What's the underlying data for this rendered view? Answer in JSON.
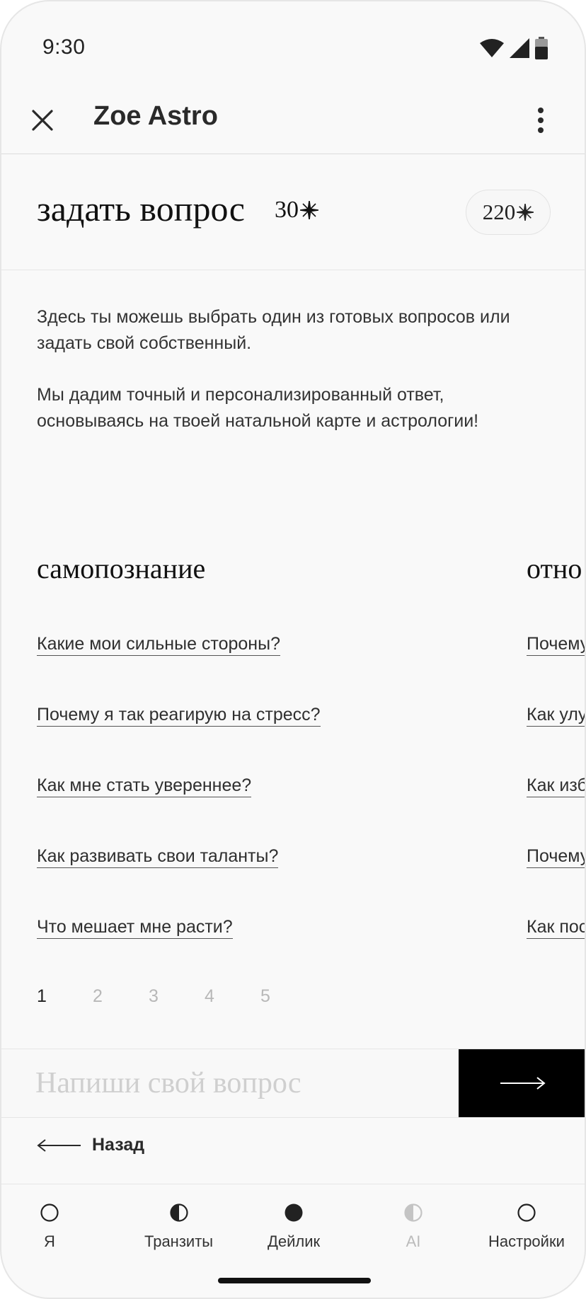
{
  "status": {
    "time": "9:30"
  },
  "app_bar": {
    "title": "Zoe Astro"
  },
  "header": {
    "title": "задать вопрос",
    "cost": "30",
    "balance": "220"
  },
  "intro": {
    "p1": "Здесь ты можешь выбрать один из готовых вопросов или задать свой собственный.",
    "p2": "Мы дадим точный и персонализированный ответ, основываясь на твоей натальной карте и астрологии!"
  },
  "categories": [
    {
      "title": "самопознание",
      "questions": [
        "Какие мои сильные стороны?",
        "Почему я так реагирую на стресс?",
        "Как мне стать увереннее?",
        "Как развивать свои таланты?",
        "Что мешает мне расти?"
      ]
    },
    {
      "title": "отно",
      "questions": [
        "Почему",
        "Как улу",
        "Как изб",
        "Почему",
        "Как пос"
      ]
    }
  ],
  "pagination": {
    "pages": [
      "1",
      "2",
      "3",
      "4",
      "5"
    ],
    "active": "1"
  },
  "input": {
    "placeholder": "Напиши свой вопрос"
  },
  "back": {
    "label": "Назад"
  },
  "nav": {
    "items": [
      {
        "label": "Я",
        "icon": "circle-outline-icon"
      },
      {
        "label": "Транзиты",
        "icon": "half-circle-icon"
      },
      {
        "label": "Дейлик",
        "icon": "filled-circle-icon"
      },
      {
        "label": "AI",
        "icon": "half-circle-disabled-icon"
      },
      {
        "label": "Настройки",
        "icon": "circle-outline-icon"
      }
    ]
  },
  "colors": {
    "accent": "#000000",
    "background": "#f9f9f9",
    "muted": "#b8b8b8"
  }
}
